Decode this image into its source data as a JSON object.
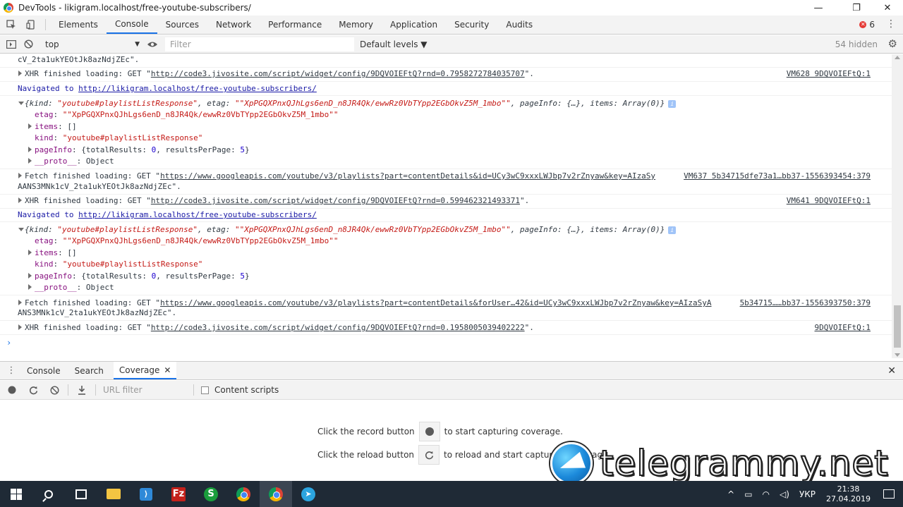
{
  "window": {
    "title": "DevTools - likigram.localhost/free-youtube-subscribers/",
    "minimize": "—",
    "maximize": "❐",
    "close": "✕"
  },
  "tabs": [
    "Elements",
    "Console",
    "Sources",
    "Network",
    "Performance",
    "Memory",
    "Application",
    "Security",
    "Audits"
  ],
  "active_tab": "Console",
  "error_count": "6",
  "console_toolbar": {
    "context": "top",
    "filter_placeholder": "Filter",
    "levels": "Default levels ▼",
    "hidden": "54 hidden"
  },
  "console": {
    "l0": "cV_2ta1ukYEOtJk8azNdjZEc\".",
    "l1_pre": "XHR finished loading: GET \"",
    "l1_url": "http://code3.jivosite.com/script/widget/config/9DQVOIEFtQ?rnd=0.7958272784035707",
    "l1_post": "\".",
    "l1_src": "VM628 9DQVOIEFtQ:1",
    "nav1_pre": "Navigated to ",
    "nav1_url": "http://likigram.localhost/free-youtube-subscribers/",
    "obj1_a": "{kind: ",
    "obj1_kind": "\"youtube#playlistListResponse\"",
    "obj1_b": ", etag: ",
    "obj1_etag": "\"\"XpPGQXPnxQJhLgs6enD_n8JR4Qk/ewwRz0VbTYpp2EGbOkvZ5M_1mbo\"\"",
    "obj1_c": ", pageInfo: {…}, items: Array(0)}",
    "etag_key": "etag",
    "etag_val": "\"\"XpPGQXPnxQJhLgs6enD_n8JR4Qk/ewwRz0VbTYpp2EGbOkvZ5M_1mbo\"\"",
    "items_key": "items",
    "items_val": "[]",
    "kind_key": "kind",
    "kind_val": "\"youtube#playlistListResponse\"",
    "pageinfo_key": "pageInfo",
    "pageinfo_a": "{totalResults: ",
    "pageinfo_total": "0",
    "pageinfo_b": ", resultsPerPage: ",
    "pageinfo_per": "5",
    "pageinfo_c": "}",
    "proto_key": "__proto__",
    "proto_val": "Object",
    "f1_pre": "Fetch finished loading: GET \"",
    "f1_url": "https://www.googleapis.com/youtube/v3/playlists?part=contentDetails&id=UCy3wC9xxxLWJbp7v2rZnyaw&key=AIzaSy",
    "f1_src": "VM637 5b34715dfe73a1…bb37-1556393454:379",
    "f1_cont": "AANS3MNk1cV_2ta1ukYEOtJk8azNdjZEc\".",
    "l2_pre": "XHR finished loading: GET \"",
    "l2_url": "http://code3.jivosite.com/script/widget/config/9DQVOIEFtQ?rnd=0.599462321493371",
    "l2_post": "\".",
    "l2_src": "VM641 9DQVOIEFtQ:1",
    "nav2_pre": "Navigated to ",
    "nav2_url": "http://likigram.localhost/free-youtube-subscribers/",
    "f2_pre": "Fetch finished loading: GET \"",
    "f2_url": "https://www.googleapis.com/youtube/v3/playlists?part=contentDetails&forUser…42&id=UCy3wC9xxxLWJbp7v2rZnyaw&key=AIzaSyA",
    "f2_src": "5b34715……bb37-1556393750:379",
    "f2_cont": "ANS3MNk1cV_2ta1ukYEOtJk8azNdjZEc\".",
    "l3_pre": "XHR finished loading: GET \"",
    "l3_url": "http://code3.jivosite.com/script/widget/config/9DQVOIEFtQ?rnd=0.1958005039402222",
    "l3_post": "\".",
    "l3_src": "9DQVOIEFtQ:1",
    "prompt": "›"
  },
  "drawer": {
    "tabs": [
      "Console",
      "Search",
      "Coverage"
    ],
    "active": "Coverage",
    "close_tab": "✕",
    "close": "✕",
    "url_filter_placeholder": "URL filter",
    "content_scripts": "Content scripts",
    "record_pre": "Click the record button",
    "record_post": "to start capturing coverage.",
    "reload_pre": "Click the reload button",
    "reload_post": "to reload and start capturing coverage."
  },
  "watermark": "telegrammy.net",
  "taskbar": {
    "lang": "УКР",
    "time": "21:38",
    "date": "27.04.2019"
  }
}
